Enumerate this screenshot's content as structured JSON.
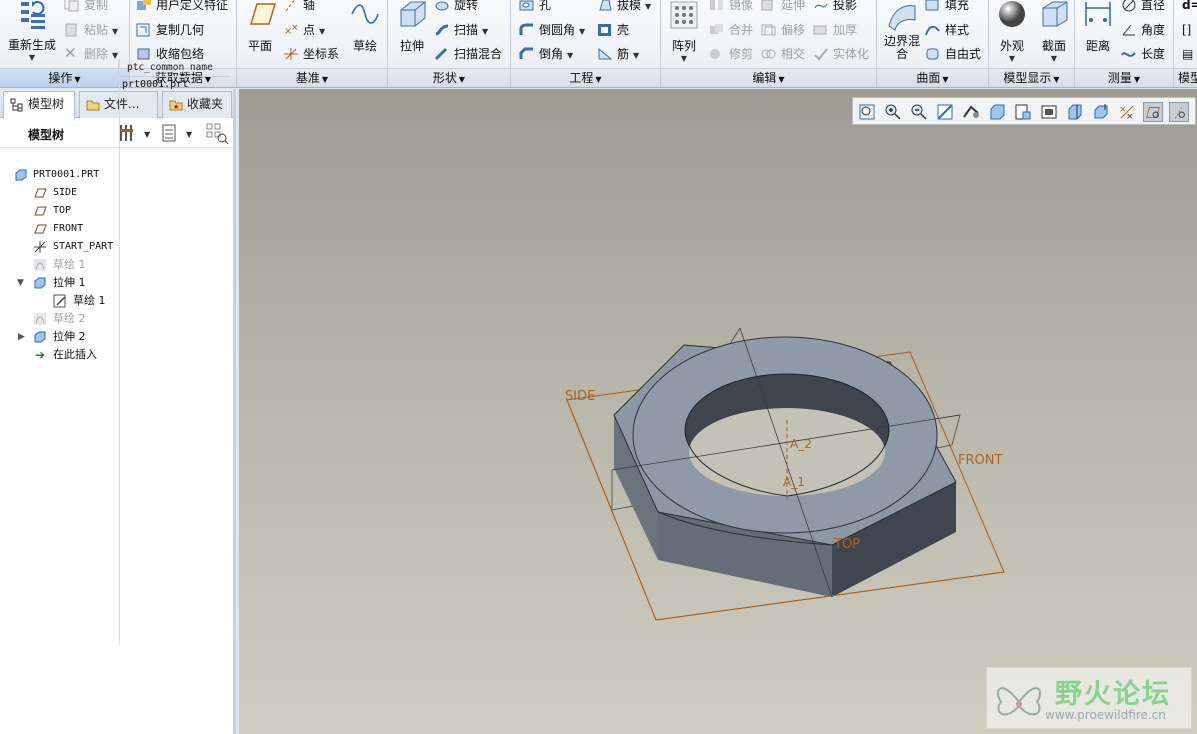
{
  "ribbon": {
    "ops": {
      "label": "操作",
      "regen": "重新生成",
      "copy": "复制",
      "paste": "粘贴",
      "delete": "删除"
    },
    "getdata": {
      "label": "获取数据",
      "udf": "用户定义特征",
      "copygeom": "复制几何",
      "shrinkwrap": "收缩包络"
    },
    "datum": {
      "label": "基准",
      "plane": "平面",
      "axis": "轴",
      "point": "点",
      "csys": "坐标系",
      "sketch": "草绘"
    },
    "shapes": {
      "label": "形状",
      "extrude": "拉伸",
      "revolve": "旋转",
      "sweep": "扫描",
      "swept_blend": "扫描混合"
    },
    "engineering": {
      "label": "工程",
      "hole": "孔",
      "round": "倒圆角",
      "chamfer": "倒角",
      "draft": "拔模",
      "shell": "壳",
      "rib": "筋"
    },
    "editing": {
      "label": "编辑",
      "pattern": "阵列",
      "mirror": "镜像",
      "merge": "合并",
      "trim": "修剪",
      "extend": "延伸",
      "offset": "偏移",
      "intersect": "相交",
      "project": "投影",
      "thicken": "加厚",
      "solidify": "实体化"
    },
    "surfaces": {
      "label": "曲面",
      "boundary_blend": "边界混合",
      "fill": "填充",
      "style": "样式",
      "freestyle": "自由式"
    },
    "display": {
      "label": "模型显示",
      "appearance": "外观",
      "section": "截面"
    },
    "measure": {
      "label": "测量",
      "distance": "距离",
      "diameter": "直径",
      "angle": "角度",
      "length": "长度"
    },
    "model_intent": {
      "label": "模型"
    }
  },
  "left": {
    "tabs": [
      "模型树",
      "文件...",
      "收藏夹"
    ],
    "tree_title": "模型树",
    "column_header": "ptc_common_name",
    "items": [
      {
        "name": "PRT0001.PRT",
        "value": "prt0001.prt"
      },
      {
        "name": "SIDE"
      },
      {
        "name": "TOP"
      },
      {
        "name": "FRONT"
      },
      {
        "name": "START_PART"
      },
      {
        "name": "草绘 1"
      },
      {
        "name": "拉伸 1"
      },
      {
        "name": "草绘 1"
      },
      {
        "name": "草绘 2"
      },
      {
        "name": "拉伸 2"
      },
      {
        "name": "在此插入"
      }
    ]
  },
  "viewport": {
    "labels": {
      "side": "SIDE",
      "front": "FRONT",
      "top": "TOP",
      "a1": "A_1",
      "a2": "A_2"
    }
  },
  "watermark": {
    "title": "野火论坛",
    "url": "www.proewildfire.cn"
  },
  "colors": {
    "datum": "#b0651e",
    "part_top": "#8a95a3",
    "part_side": "#5e6671",
    "ribbon_active": "#cfe0f2",
    "insert_arrow": "#1a7a1a"
  }
}
